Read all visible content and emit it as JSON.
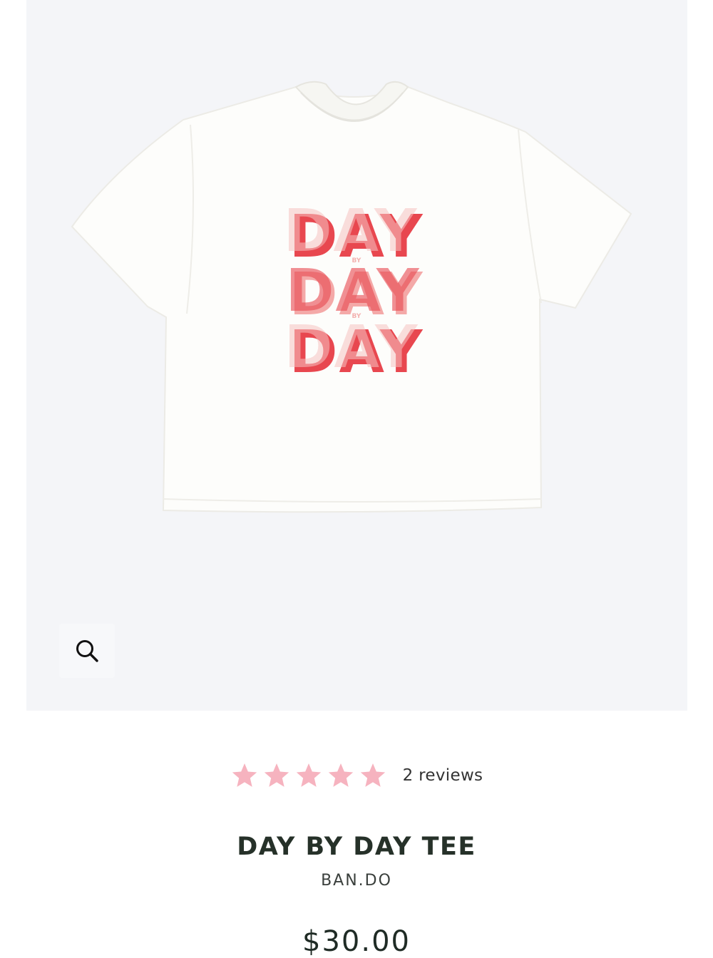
{
  "product": {
    "image_alt": "White cropped tee with DAY BY DAY BY DAY graphic",
    "print_line1": "DAY",
    "print_line2": "DAY",
    "print_line3": "DAY",
    "print_small": "BY",
    "rating": 5,
    "rating_max": 5,
    "reviews_label": "2 reviews",
    "title": "DAY BY DAY TEE",
    "brand": "BAN.DO",
    "price": "$30.00"
  },
  "icons": {
    "zoom": "search-icon",
    "star": "star-icon"
  },
  "colors": {
    "gallery_bg": "#f4f5f8",
    "star": "#f6b3bf",
    "print_red": "#e8474f",
    "print_pink": "#f7c4c2",
    "title": "#263129"
  }
}
